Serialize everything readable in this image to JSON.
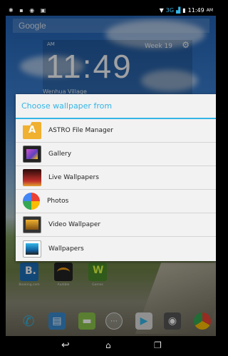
{
  "status_bar": {
    "network": "3G",
    "time": "11:49",
    "ampm": "AM"
  },
  "search": {
    "placeholder": "Google"
  },
  "clock": {
    "ampm": "AM",
    "week": "Week 19",
    "time": "11:49",
    "location": "Wenhua Village"
  },
  "dialog": {
    "title": "Choose wallpaper from",
    "options": [
      {
        "label": "ASTRO File Manager",
        "icon": "astro-icon"
      },
      {
        "label": "Gallery",
        "icon": "gallery-icon"
      },
      {
        "label": "Live Wallpapers",
        "icon": "live-wallpapers-icon"
      },
      {
        "label": "Photos",
        "icon": "photos-icon"
      },
      {
        "label": "Video Wallpaper",
        "icon": "video-wallpaper-icon"
      },
      {
        "label": "Wallpapers",
        "icon": "wallpapers-icon"
      }
    ]
  },
  "home_apps": [
    {
      "label": "Booking.com"
    },
    {
      "label": "Audible"
    },
    {
      "label": "Games"
    }
  ],
  "colors": {
    "accent": "#33b5e5",
    "dialog_bg": "#f2f2f2"
  }
}
